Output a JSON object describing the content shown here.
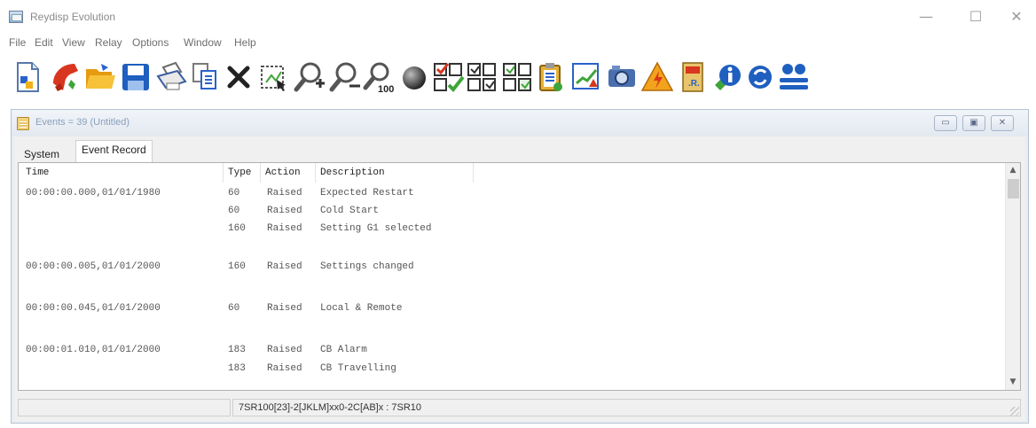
{
  "app": {
    "title": "Reydisp Evolution",
    "window_controls": {
      "minimize": "—",
      "maximize": "☐",
      "close": "✕"
    }
  },
  "menu": [
    "File",
    "Edit",
    "View",
    "Relay",
    "Options",
    "Window",
    "Help"
  ],
  "toolbar": [
    "new-document-icon",
    "connect-phone-icon",
    "open-folder-icon",
    "save-disk-icon",
    "print-icon",
    "copy-icon",
    "delete-x-icon",
    "select-region-icon",
    "zoom-in-icon",
    "zoom-out-icon",
    "zoom-100-icon",
    "record-ball-icon",
    "check-list-icon",
    "grid-settings-icon",
    "grid-compare-icon",
    "clipboard-icon",
    "trend-chart-icon",
    "camera-icon",
    "warning-icon",
    "relay-card-icon",
    "info-icon",
    "refresh-icon",
    "users-icon"
  ],
  "child_window": {
    "title": "Events = 39 (Untitled)",
    "controls": {
      "minimize": "▭",
      "restore": "▣",
      "close": "✕"
    },
    "tabs": [
      {
        "label": "System",
        "active": false
      },
      {
        "label": "Event Record",
        "active": true
      }
    ],
    "columns": [
      "Time",
      "Type",
      "Action",
      "Description"
    ],
    "rows": [
      {
        "time": "00:00:00.000,01/01/1980",
        "type": "60",
        "action": "Raised",
        "description": "Expected Restart"
      },
      {
        "time": "",
        "type": "60",
        "action": "Raised",
        "description": "Cold Start"
      },
      {
        "time": "",
        "type": "160",
        "action": "Raised",
        "description": "Setting G1 selected"
      },
      {
        "time": "00:00:00.005,01/01/2000",
        "type": "160",
        "action": "Raised",
        "description": "Settings changed"
      },
      {
        "time": "00:00:00.045,01/01/2000",
        "type": "60",
        "action": "Raised",
        "description": "Local & Remote"
      },
      {
        "time": "00:00:01.010,01/01/2000",
        "type": "183",
        "action": "Raised",
        "description": "CB Alarm"
      },
      {
        "time": "",
        "type": "183",
        "action": "Raised",
        "description": "CB Travelling"
      }
    ],
    "scrollbar": {
      "up": "▲",
      "down": "▼"
    },
    "status": {
      "left": "",
      "right": "7SR100[23]-2[JKLM]xx0-2C[AB]x : 7SR10"
    }
  },
  "colors": {
    "accent_blue": "#1f5fbf",
    "toolbar_red": "#d8361e",
    "toolbar_green": "#3fa53a",
    "toolbar_orange": "#f2a21b"
  }
}
